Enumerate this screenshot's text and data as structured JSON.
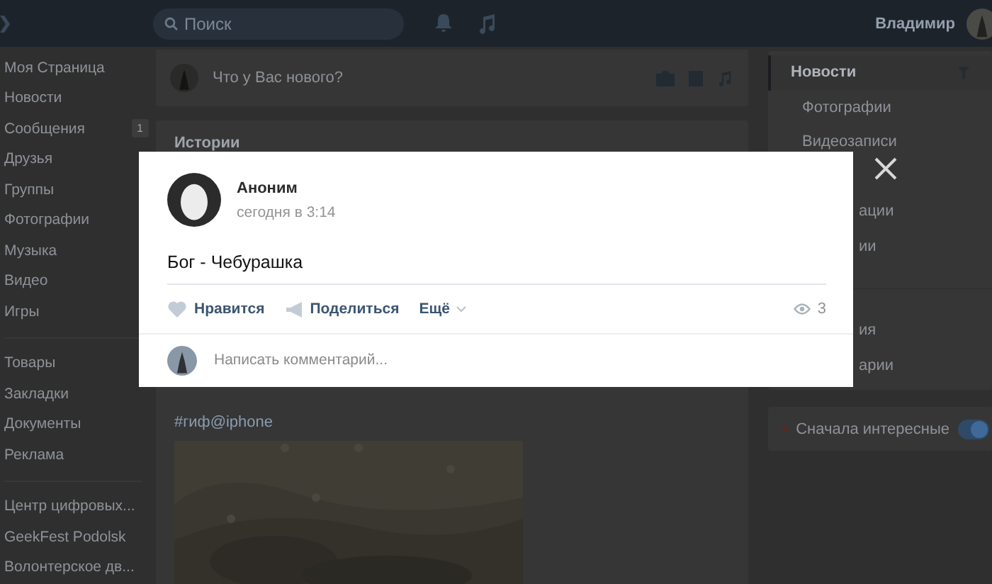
{
  "header": {
    "search": {
      "placeholder": "Поиск"
    },
    "user_name": "Владимир"
  },
  "sidebar": {
    "groups": [
      {
        "items": [
          {
            "label": "Моя Страница"
          },
          {
            "label": "Новости"
          },
          {
            "label": "Сообщения",
            "badge": "1"
          },
          {
            "label": "Друзья"
          },
          {
            "label": "Группы"
          },
          {
            "label": "Фотографии"
          },
          {
            "label": "Музыка"
          },
          {
            "label": "Видео"
          },
          {
            "label": "Игры"
          }
        ]
      },
      {
        "items": [
          {
            "label": "Товары"
          },
          {
            "label": "Закладки"
          },
          {
            "label": "Документы"
          },
          {
            "label": "Реклама"
          }
        ]
      },
      {
        "items": [
          {
            "label": "Центр цифровых..."
          },
          {
            "label": "GeekFest Podolsk"
          },
          {
            "label": "Волонтерское дв..."
          }
        ]
      }
    ]
  },
  "composer": {
    "placeholder": "Что у Вас нового?"
  },
  "stories": {
    "title": "Истории"
  },
  "post": {
    "hashtag": "#гиф@iphone"
  },
  "right_nav": {
    "groups": [
      {
        "items": [
          {
            "label": "Новости",
            "selected": true,
            "kind": "link"
          },
          {
            "label": "Фотографии",
            "selected": false,
            "kind": "link"
          },
          {
            "label": "Видеозаписи",
            "selected": false,
            "kind": "link"
          },
          {
            "label": "ации",
            "selected": false,
            "kind": "partial"
          },
          {
            "label": "ии",
            "selected": false,
            "kind": "partial"
          }
        ]
      },
      {
        "items": [
          {
            "label": "ия",
            "selected": false,
            "kind": "partial"
          },
          {
            "label": "арии",
            "selected": false,
            "kind": "partial"
          }
        ]
      }
    ]
  },
  "sort_toggle": {
    "label": "Сначала интересные",
    "on": true
  },
  "modal": {
    "author": "Аноним",
    "time": "сегодня в 3:14",
    "text": "Бог - Чебурашка",
    "actions": [
      {
        "label": "Нравится",
        "kind": "like"
      },
      {
        "label": "Поделиться",
        "kind": "share"
      },
      {
        "label": "Ещё",
        "kind": "more"
      }
    ],
    "views": "3",
    "comment": {
      "placeholder": "Написать комментарий..."
    }
  }
}
